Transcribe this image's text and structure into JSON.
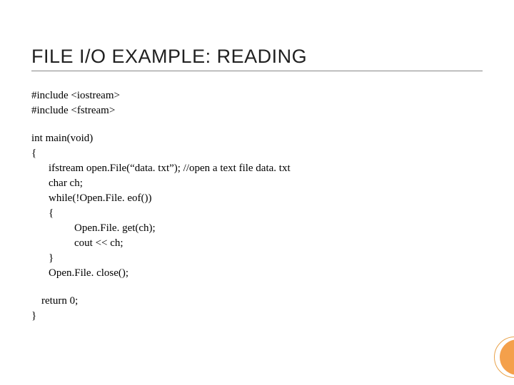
{
  "title": "FILE I/O EXAMPLE: READING",
  "code": {
    "inc1": "#include <iostream>",
    "inc2": "#include <fstream>",
    "main_sig": "int main(void)",
    "open_brace": "{",
    "l_ifstream": "ifstream open.File(“data. txt”); //open a text file data. txt",
    "l_char": "char ch;",
    "l_while": "while(!Open.File. eof())",
    "l_while_open": "{",
    "l_get": "Open.File. get(ch);",
    "l_cout": "cout << ch;",
    "l_while_close": "}",
    "l_close": "Open.File. close();",
    "l_return": "return 0;",
    "close_brace": "}"
  }
}
